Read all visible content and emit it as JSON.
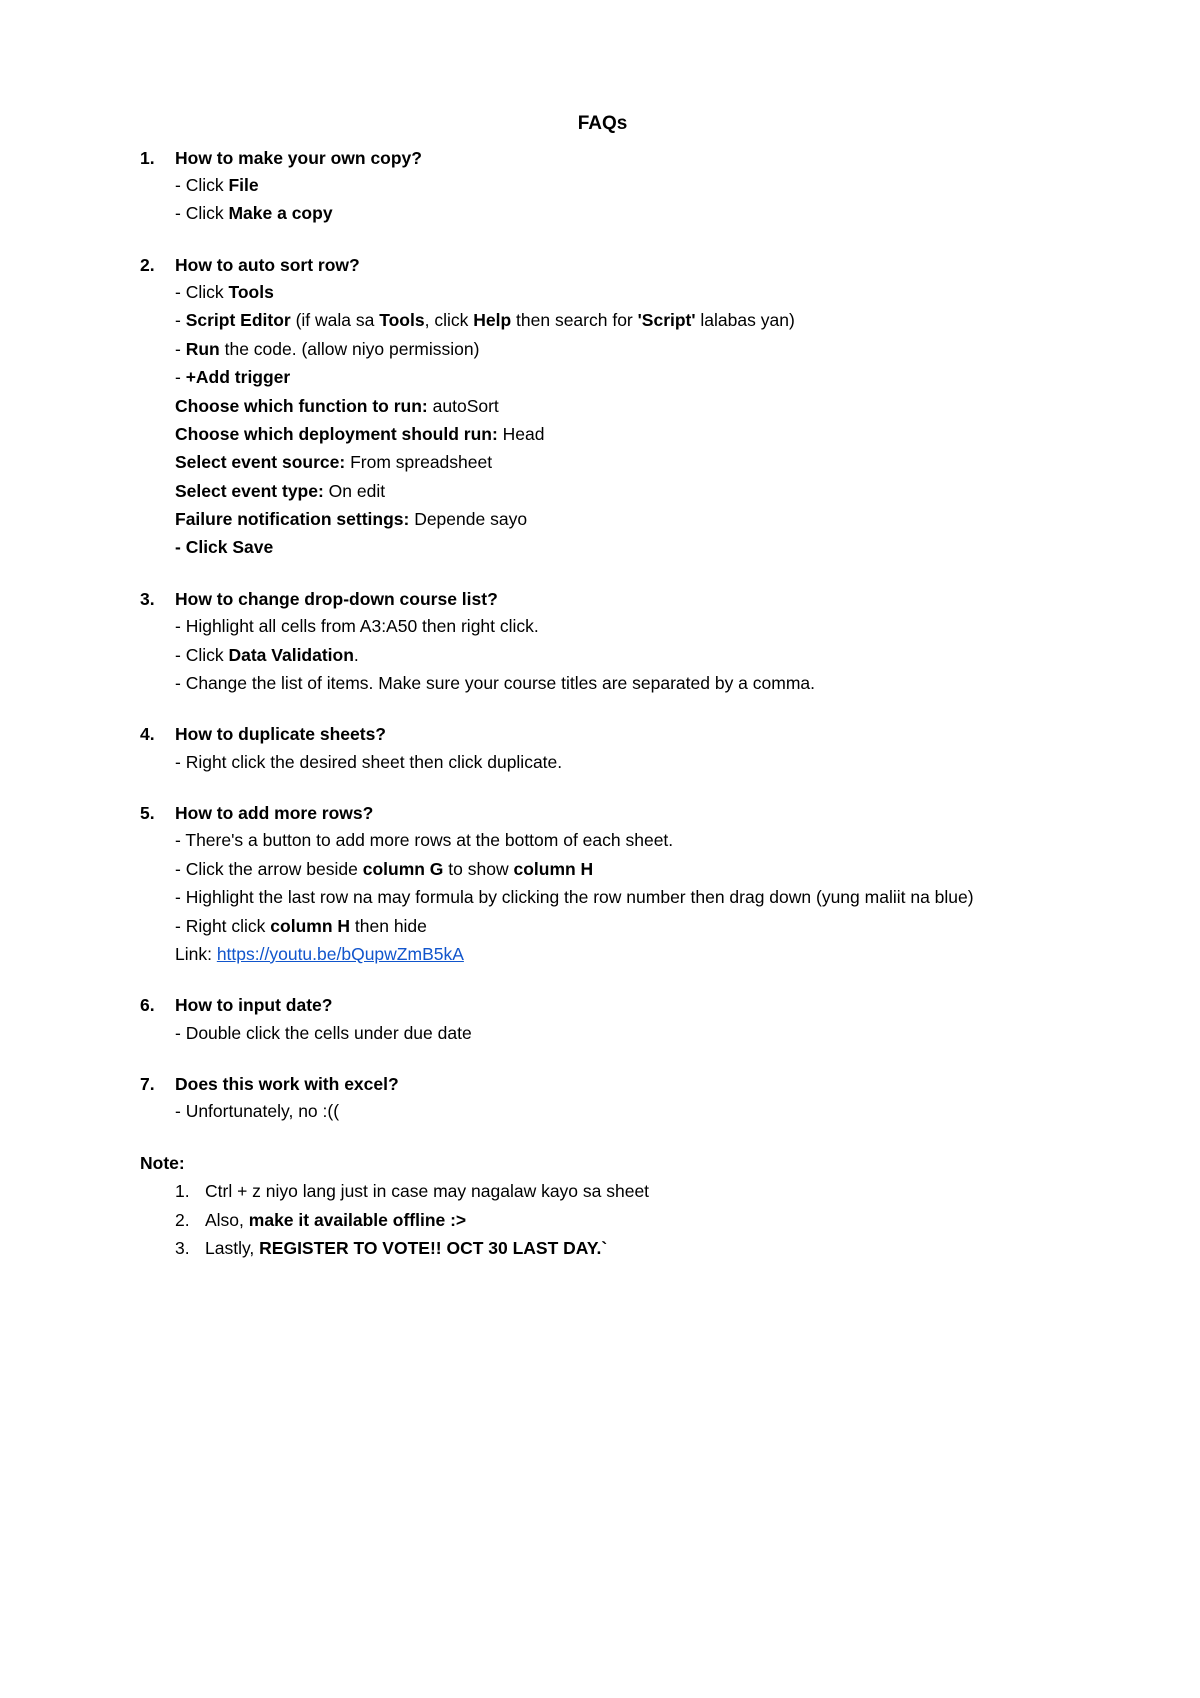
{
  "title": "FAQs",
  "faqs": [
    {
      "num": "1.",
      "question": "How to make your own copy?",
      "lines": [
        [
          {
            "t": "- Click "
          },
          {
            "t": "File",
            "b": true
          }
        ],
        [
          {
            "t": "- Click "
          },
          {
            "t": "Make a copy",
            "b": true
          }
        ]
      ]
    },
    {
      "num": "2.",
      "question": "How to auto sort row?",
      "lines": [
        [
          {
            "t": "- Click "
          },
          {
            "t": "Tools",
            "b": true
          }
        ],
        [
          {
            "t": "- "
          },
          {
            "t": "Script Editor",
            "b": true
          },
          {
            "t": " (if wala sa "
          },
          {
            "t": "Tools",
            "b": true
          },
          {
            "t": ", click "
          },
          {
            "t": "Help",
            "b": true
          },
          {
            "t": " then search for "
          },
          {
            "t": "'Script'",
            "b": true
          },
          {
            "t": " lalabas yan)"
          }
        ],
        [
          {
            "t": "- "
          },
          {
            "t": "Run",
            "b": true
          },
          {
            "t": " the code. (allow niyo permission)"
          }
        ],
        [
          {
            "t": "- "
          },
          {
            "t": "+Add trigger",
            "b": true
          }
        ],
        [
          {
            "t": "Choose which function to run:",
            "b": true
          },
          {
            "t": " autoSort"
          }
        ],
        [
          {
            "t": "Choose which deployment should run:",
            "b": true
          },
          {
            "t": " Head"
          }
        ],
        [
          {
            "t": "Select event source:",
            "b": true
          },
          {
            "t": " From spreadsheet"
          }
        ],
        [
          {
            "t": "Select event type:",
            "b": true
          },
          {
            "t": " On edit"
          }
        ],
        [
          {
            "t": "Failure notification settings:",
            "b": true
          },
          {
            "t": " Depende sayo"
          }
        ],
        [
          {
            "t": "- Click Save",
            "b": true
          }
        ]
      ]
    },
    {
      "num": "3.",
      "question": "How to change drop-down course list?",
      "lines": [
        [
          {
            "t": "- Highlight all cells from A3:A50 then right click."
          }
        ],
        [
          {
            "t": "- Click "
          },
          {
            "t": "Data Validation",
            "b": true
          },
          {
            "t": "."
          }
        ],
        [
          {
            "t": "- Change the list of items. Make sure your course titles are separated by a comma."
          }
        ]
      ]
    },
    {
      "num": "4.",
      "question": "How to duplicate sheets?",
      "lines": [
        [
          {
            "t": "- Right click the desired sheet then click duplicate."
          }
        ]
      ]
    },
    {
      "num": "5.",
      "question": "How to add more rows?",
      "lines": [
        [
          {
            "t": "- There's a button to add more rows at the bottom of each sheet."
          }
        ],
        [
          {
            "t": "- Click the arrow beside "
          },
          {
            "t": "column G",
            "b": true
          },
          {
            "t": " to show "
          },
          {
            "t": "column H",
            "b": true
          }
        ],
        [
          {
            "t": "- Highlight the last row na may formula by clicking the row number then drag down (yung maliit na blue)"
          }
        ],
        [
          {
            "t": "- Right click "
          },
          {
            "t": "column H",
            "b": true
          },
          {
            "t": " then hide"
          }
        ],
        [
          {
            "t": "Link: "
          },
          {
            "t": "https://youtu.be/bQupwZmB5kA",
            "link": true
          }
        ]
      ]
    },
    {
      "num": "6.",
      "question": "How to input date?",
      "lines": [
        [
          {
            "t": "- Double click the cells under due date"
          }
        ]
      ]
    },
    {
      "num": "7.",
      "question": "Does this work with excel?",
      "lines": [
        [
          {
            "t": "- Unfortunately, no :(("
          }
        ]
      ]
    }
  ],
  "note": {
    "title": "Note:",
    "items": [
      {
        "num": "1.",
        "parts": [
          {
            "t": "Ctrl + z niyo lang just in case may nagalaw kayo sa sheet"
          }
        ]
      },
      {
        "num": "2.",
        "parts": [
          {
            "t": "Also, "
          },
          {
            "t": "make it available offline :>",
            "b": true
          }
        ]
      },
      {
        "num": "3.",
        "parts": [
          {
            "t": "Lastly, "
          },
          {
            "t": "REGISTER TO VOTE!! OCT 30 LAST DAY.`",
            "b": true
          }
        ]
      }
    ]
  }
}
